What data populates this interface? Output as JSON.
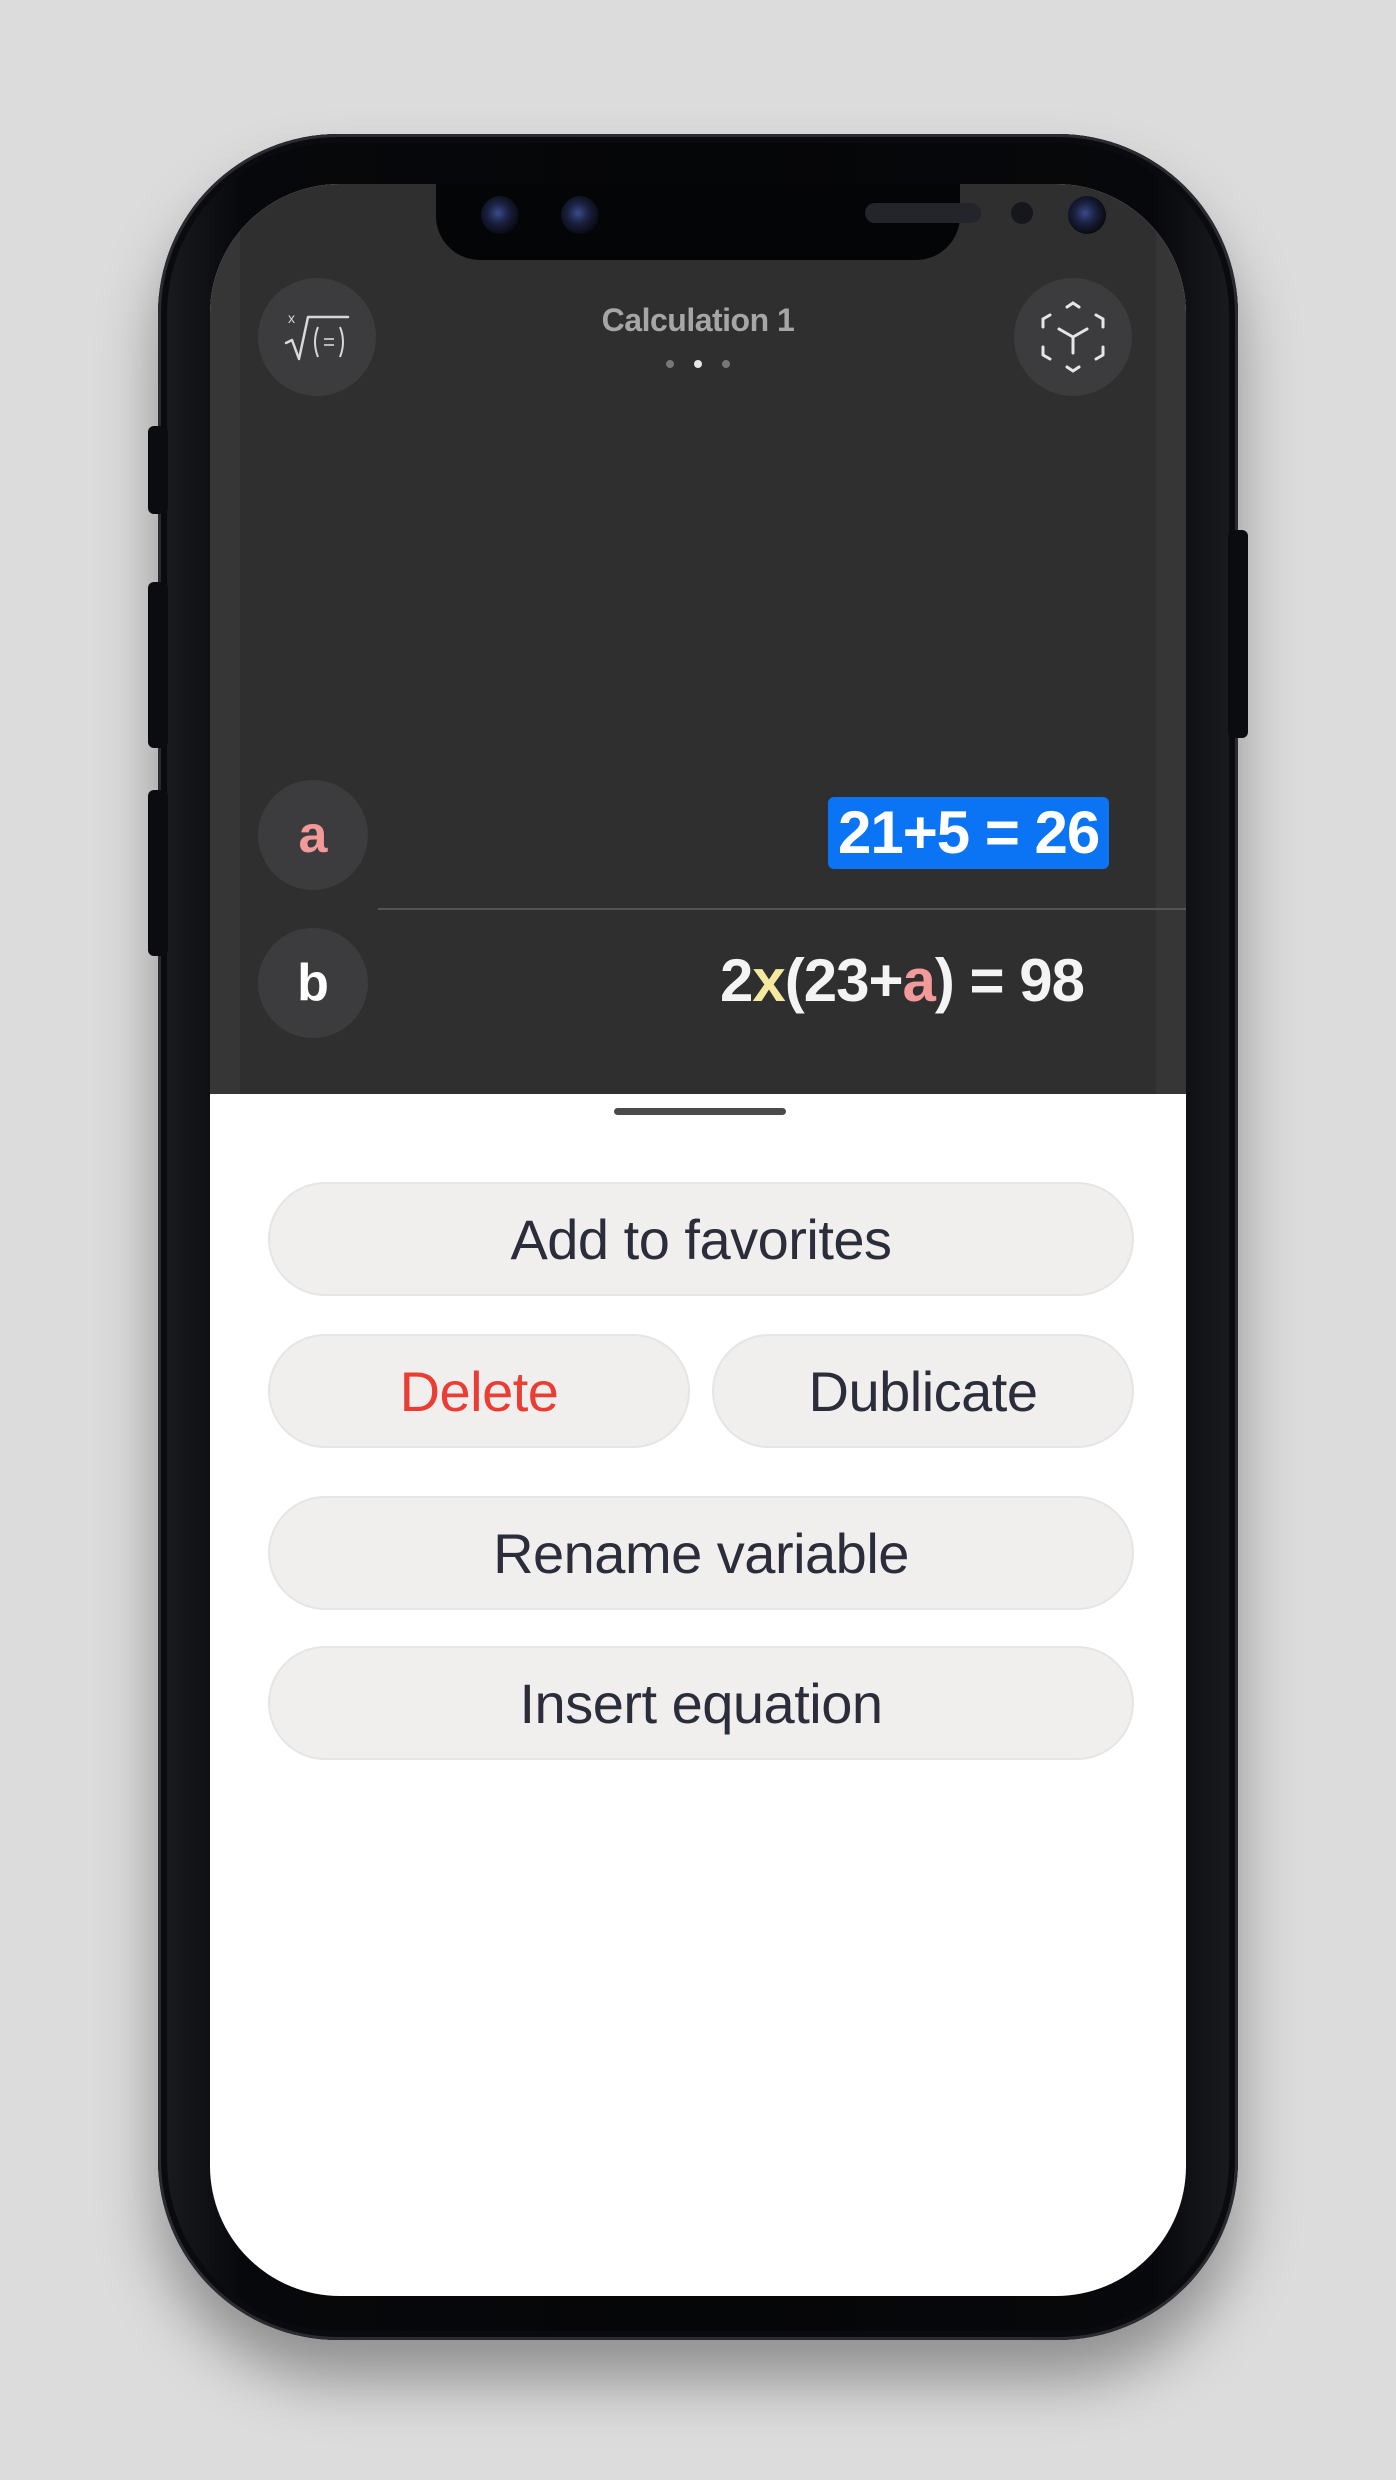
{
  "header": {
    "title": "Calculation 1",
    "pages": [
      {
        "active": false
      },
      {
        "active": true
      },
      {
        "active": false
      }
    ],
    "left_button_icon": "nth-root-icon",
    "right_button_icon": "ar-cube-icon"
  },
  "rows": [
    {
      "variable": "a",
      "variable_color": "#f29a9a",
      "expression": "21+5 = 26",
      "selected": true
    },
    {
      "variable": "b",
      "variable_color": "#ffffff",
      "expression_parts": [
        {
          "text": "2",
          "color": "#f4f4f4"
        },
        {
          "text": "x",
          "color": "#f5e9a0"
        },
        {
          "text": "(23+",
          "color": "#f4f4f4"
        },
        {
          "text": "a",
          "color": "#f29a9a"
        },
        {
          "text": ") = 98",
          "color": "#f4f4f4"
        }
      ]
    }
  ],
  "sheet": {
    "add_favorites": "Add to favorites",
    "delete": "Delete",
    "duplicate": "Dublicate",
    "rename": "Rename variable",
    "insert": "Insert equation"
  },
  "colors": {
    "selection_blue": "#0a74f5",
    "danger_red": "#ea3d33",
    "dark_bg": "#2f2f30"
  }
}
